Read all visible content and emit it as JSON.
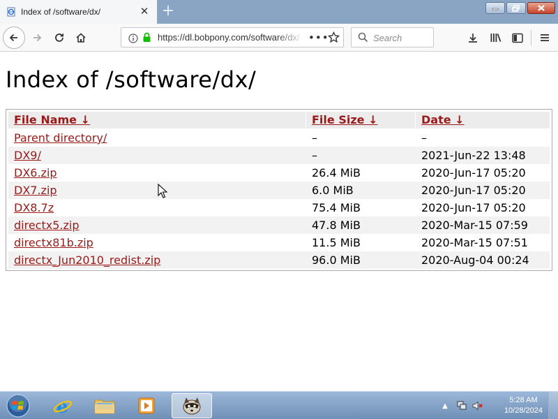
{
  "browser": {
    "tab": {
      "title": "Index of /software/dx/"
    },
    "address_bar": {
      "url": "https://dl.bobpony.com/software/dx/"
    },
    "search": {
      "placeholder": "Search"
    }
  },
  "page": {
    "title": "Index of /software/dx/",
    "table": {
      "headers": {
        "name": "File Name  ↓",
        "size": "File Size  ↓",
        "date": "Date  ↓"
      },
      "rows": [
        {
          "name": "Parent directory/",
          "size": "–",
          "date": "–"
        },
        {
          "name": "DX9/",
          "size": "–",
          "date": "2021-Jun-22 13:48"
        },
        {
          "name": "DX6.zip",
          "size": "26.4 MiB",
          "date": "2020-Jun-17 05:20"
        },
        {
          "name": "DX7.zip",
          "size": "6.0 MiB",
          "date": "2020-Jun-17 05:20"
        },
        {
          "name": "DX8.7z",
          "size": "75.4 MiB",
          "date": "2020-Jun-17 05:20"
        },
        {
          "name": "directx5.zip",
          "size": "47.8 MiB",
          "date": "2020-Mar-15 07:59"
        },
        {
          "name": "directx81b.zip",
          "size": "11.5 MiB",
          "date": "2020-Mar-15 07:51"
        },
        {
          "name": "directx_Jun2010_redist.zip",
          "size": "96.0 MiB",
          "date": "2020-Aug-04 00:24"
        }
      ]
    }
  },
  "taskbar": {
    "apps": [
      "internet-explorer",
      "file-explorer",
      "media-player",
      "firefox"
    ],
    "clock": {
      "time": "5:28 AM",
      "date": "10/28/2024"
    }
  },
  "colors": {
    "link": "#9a1a1a",
    "taskbar": "#7f9fc5",
    "tabstrip": "#8aa4c3",
    "row_alt": "#f2f2f2"
  }
}
